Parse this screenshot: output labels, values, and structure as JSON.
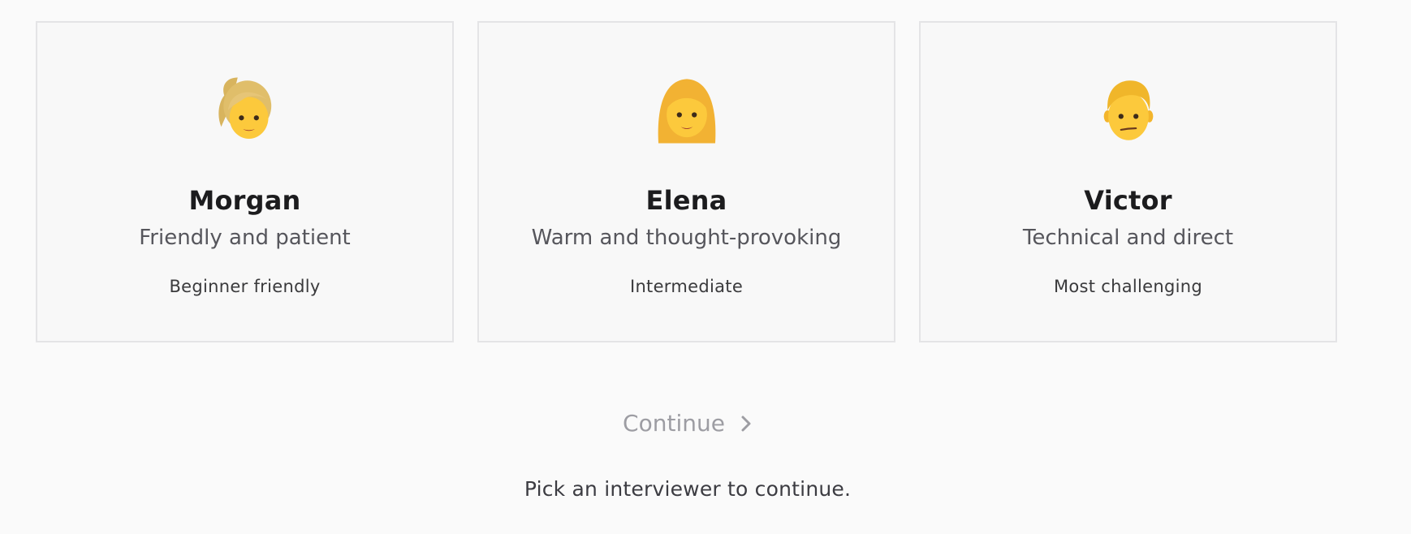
{
  "interviewers": [
    {
      "avatar_icon": "woman-ponytail-emoji-icon",
      "name": "Morgan",
      "description": "Friendly and patient",
      "level": "Beginner friendly"
    },
    {
      "avatar_icon": "woman-long-hair-emoji-icon",
      "name": "Elena",
      "description": "Warm and thought-provoking",
      "level": "Intermediate"
    },
    {
      "avatar_icon": "man-short-hair-emoji-icon",
      "name": "Victor",
      "description": "Technical and direct",
      "level": "Most challenging"
    }
  ],
  "continue_button": {
    "label": "Continue",
    "icon": "chevron-right-icon",
    "disabled": true
  },
  "hint": "Pick an interviewer to continue.",
  "colors": {
    "background": "#fafafa",
    "card_background": "#f8f8f8",
    "card_border": "#e4e4e6",
    "disabled_text": "#9d9da3"
  }
}
